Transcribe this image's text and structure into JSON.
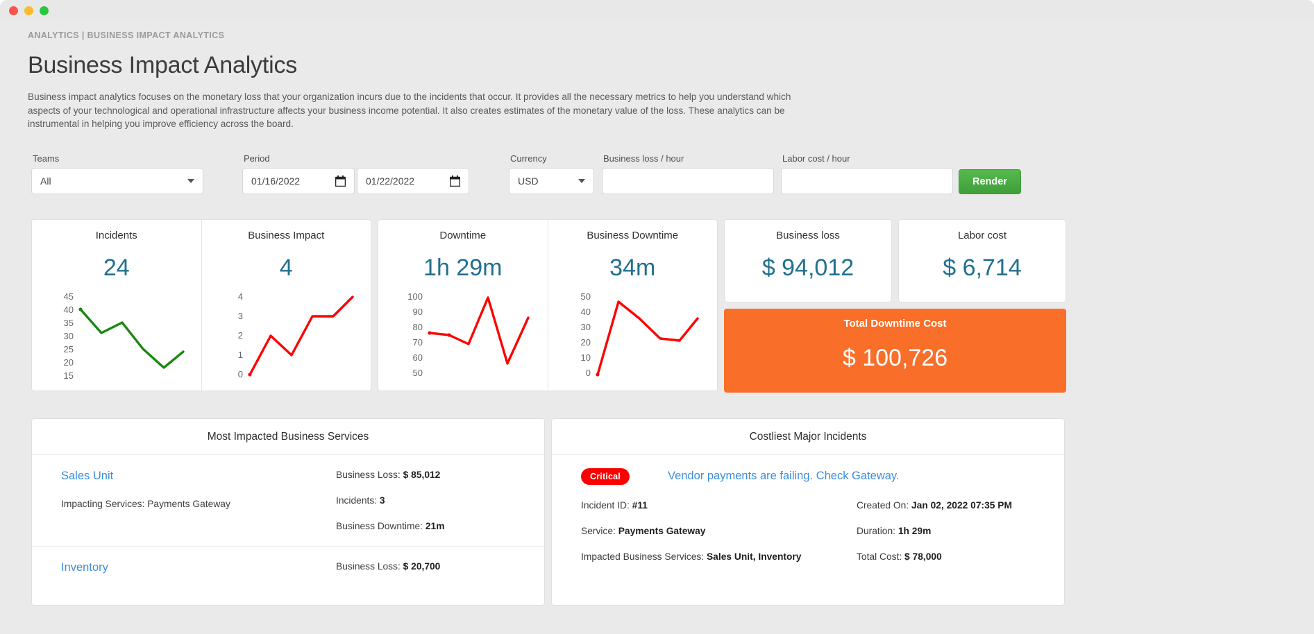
{
  "window": {
    "close_label": "close",
    "minimize_label": "minimize",
    "maximize_label": "maximize"
  },
  "header": {
    "breadcrumb": "ANALYTICS | BUSINESS IMPACT ANALYTICS",
    "title": "Business Impact Analytics",
    "description": "Business impact analytics focuses on the monetary loss that your organization incurs due to the incidents that occur. It provides all the necessary metrics to help you understand which aspects of your technological and operational infrastructure affects your business income potential. It also creates estimates of the monetary value of the loss. These analytics can be instrumental in helping you improve efficiency across the board."
  },
  "filters": {
    "teams": {
      "label": "Teams",
      "value": "All",
      "options": [
        "All"
      ]
    },
    "period": {
      "label": "Period",
      "start": "01/16/2022",
      "end": "01/22/2022"
    },
    "currency": {
      "label": "Currency",
      "value": "USD",
      "options": [
        "USD"
      ]
    },
    "business_loss_hour": {
      "label": "Business loss / hour",
      "value": "",
      "placeholder": ""
    },
    "labor_cost_hour": {
      "label": "Labor cost / hour",
      "value": "",
      "placeholder": ""
    },
    "render_button": "Render"
  },
  "kpis": {
    "incidents": {
      "title": "Incidents",
      "value": "24"
    },
    "business_impact": {
      "title": "Business Impact",
      "value": "4"
    },
    "downtime": {
      "title": "Downtime",
      "value": "1h 29m"
    },
    "business_downtime": {
      "title": "Business Downtime",
      "value": "34m"
    },
    "business_loss": {
      "title": "Business loss",
      "value": "$ 94,012"
    },
    "labor_cost": {
      "title": "Labor cost",
      "value": "$ 6,714"
    },
    "total_downtime_cost": {
      "title": "Total Downtime Cost",
      "value": "$ 100,726"
    }
  },
  "chart_data": [
    {
      "type": "line",
      "title": "Incidents",
      "x": [
        1,
        2,
        3,
        4,
        5,
        6
      ],
      "values": [
        41,
        32,
        35,
        25,
        18,
        24
      ],
      "yticks": [
        45,
        40,
        35,
        30,
        25,
        20,
        15
      ],
      "ylim": [
        13,
        47
      ],
      "color": "#18880f",
      "grid": false,
      "xlabel": "",
      "ylabel": ""
    },
    {
      "type": "line",
      "title": "Business Impact",
      "x": [
        1,
        2,
        3,
        4,
        5,
        6
      ],
      "values": [
        0,
        2,
        1,
        3,
        3,
        4
      ],
      "yticks": [
        4,
        3,
        2,
        1,
        0
      ],
      "ylim": [
        0,
        4
      ],
      "color": "#ff0000",
      "grid": false,
      "xlabel": "",
      "ylabel": ""
    },
    {
      "type": "line",
      "title": "Downtime",
      "x": [
        1,
        2,
        3,
        4,
        5,
        6
      ],
      "values": [
        78,
        77,
        71,
        99,
        56,
        89
      ],
      "yticks": [
        100,
        90,
        80,
        70,
        60,
        50
      ],
      "ylim": [
        48,
        102
      ],
      "color": "#ff0000",
      "grid": false,
      "xlabel": "",
      "ylabel": ""
    },
    {
      "type": "line",
      "title": "Business Downtime",
      "x": [
        1,
        2,
        3,
        4,
        5,
        6
      ],
      "values": [
        0,
        45,
        34,
        21,
        20,
        34
      ],
      "yticks": [
        50,
        40,
        30,
        20,
        10,
        0
      ],
      "ylim": [
        0,
        50
      ],
      "color": "#ff0000",
      "grid": false,
      "xlabel": "",
      "ylabel": ""
    }
  ],
  "services_panel": {
    "title": "Most Impacted Business Services",
    "labels": {
      "impacting": "Impacting Services:",
      "business_loss": "Business Loss:",
      "incidents": "Incidents:",
      "business_downtime": "Business Downtime:"
    },
    "items": [
      {
        "name": "Sales Unit",
        "impacting_services": "Payments Gateway",
        "business_loss": "$ 85,012",
        "incidents": "3",
        "business_downtime": "21m"
      },
      {
        "name": "Inventory",
        "impacting_services": "",
        "business_loss": "$ 20,700",
        "incidents": "",
        "business_downtime": ""
      }
    ]
  },
  "incidents_panel": {
    "title": "Costliest Major Incidents",
    "labels": {
      "incident_id": "Incident ID:",
      "service": "Service:",
      "impacted": "Impacted Business Services:",
      "created_on": "Created On:",
      "duration": "Duration:",
      "total_cost": "Total Cost:"
    },
    "items": [
      {
        "severity": "Critical",
        "title": "Vendor payments are failing. Check Gateway.",
        "incident_id": "#11",
        "service": "Payments Gateway",
        "impacted": "Sales Unit, Inventory",
        "created_on": "Jan 02, 2022 07:35 PM",
        "duration": "1h 29m",
        "total_cost": "$ 78,000"
      }
    ]
  },
  "colors": {
    "accent_blue": "#21708f",
    "link_blue": "#3a8dde",
    "orange": "#f96e29",
    "green_line": "#18880f",
    "red_line": "#ff0000",
    "critical_red": "#fa0000",
    "render_green": "#3f9e39"
  }
}
